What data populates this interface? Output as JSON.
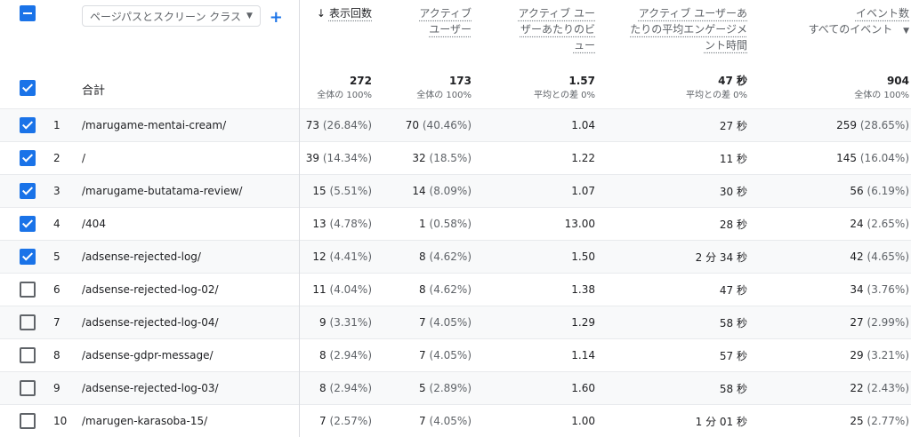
{
  "dimension_selector": "ページパスとスクリーン クラス",
  "columns": {
    "views": "表示回数",
    "active_users": "アクティブ ユーザー",
    "views_per_user": "アクティブ ユーザーあたりのビュー",
    "avg_engagement": "アクティブ ユーザーあたりの平均エンゲージメント時間",
    "events": "イベント数",
    "events_sub": "すべてのイベント"
  },
  "totals": {
    "label": "合計",
    "views": "272",
    "views_sub": "全体の 100%",
    "active_users": "173",
    "active_users_sub": "全体の 100%",
    "views_per_user": "1.57",
    "views_per_user_sub": "平均との差 0%",
    "avg_engagement": "47 秒",
    "avg_engagement_sub": "平均との差 0%",
    "events": "904",
    "events_sub": "全体の 100%"
  },
  "rows": [
    {
      "idx": "1",
      "path": "/marugame-mentai-cream/",
      "views": "73",
      "views_pct": "(26.84%)",
      "users": "70",
      "users_pct": "(40.46%)",
      "vpu": "1.04",
      "eng": "27 秒",
      "events": "259",
      "events_pct": "(28.65%)",
      "checked": true
    },
    {
      "idx": "2",
      "path": "/",
      "views": "39",
      "views_pct": "(14.34%)",
      "users": "32",
      "users_pct": "(18.5%)",
      "vpu": "1.22",
      "eng": "11 秒",
      "events": "145",
      "events_pct": "(16.04%)",
      "checked": true
    },
    {
      "idx": "3",
      "path": "/marugame-butatama-review/",
      "views": "15",
      "views_pct": "(5.51%)",
      "users": "14",
      "users_pct": "(8.09%)",
      "vpu": "1.07",
      "eng": "30 秒",
      "events": "56",
      "events_pct": "(6.19%)",
      "checked": true
    },
    {
      "idx": "4",
      "path": "/404",
      "views": "13",
      "views_pct": "(4.78%)",
      "users": "1",
      "users_pct": "(0.58%)",
      "vpu": "13.00",
      "eng": "28 秒",
      "events": "24",
      "events_pct": "(2.65%)",
      "checked": true
    },
    {
      "idx": "5",
      "path": "/adsense-rejected-log/",
      "views": "12",
      "views_pct": "(4.41%)",
      "users": "8",
      "users_pct": "(4.62%)",
      "vpu": "1.50",
      "eng": "2 分 34 秒",
      "events": "42",
      "events_pct": "(4.65%)",
      "checked": true
    },
    {
      "idx": "6",
      "path": "/adsense-rejected-log-02/",
      "views": "11",
      "views_pct": "(4.04%)",
      "users": "8",
      "users_pct": "(4.62%)",
      "vpu": "1.38",
      "eng": "47 秒",
      "events": "34",
      "events_pct": "(3.76%)",
      "checked": false
    },
    {
      "idx": "7",
      "path": "/adsense-rejected-log-04/",
      "views": "9",
      "views_pct": "(3.31%)",
      "users": "7",
      "users_pct": "(4.05%)",
      "vpu": "1.29",
      "eng": "58 秒",
      "events": "27",
      "events_pct": "(2.99%)",
      "checked": false
    },
    {
      "idx": "8",
      "path": "/adsense-gdpr-message/",
      "views": "8",
      "views_pct": "(2.94%)",
      "users": "7",
      "users_pct": "(4.05%)",
      "vpu": "1.14",
      "eng": "57 秒",
      "events": "29",
      "events_pct": "(3.21%)",
      "checked": false
    },
    {
      "idx": "9",
      "path": "/adsense-rejected-log-03/",
      "views": "8",
      "views_pct": "(2.94%)",
      "users": "5",
      "users_pct": "(2.89%)",
      "vpu": "1.60",
      "eng": "58 秒",
      "events": "22",
      "events_pct": "(2.43%)",
      "checked": false
    },
    {
      "idx": "10",
      "path": "/marugen-karasoba-15/",
      "views": "7",
      "views_pct": "(2.57%)",
      "users": "7",
      "users_pct": "(4.05%)",
      "vpu": "1.00",
      "eng": "1 分 01 秒",
      "events": "25",
      "events_pct": "(2.77%)",
      "checked": false
    }
  ],
  "icons": {
    "sort": "arrow-down-icon",
    "add": "plus-icon",
    "dropdown": "caret-down-icon"
  },
  "colors": {
    "accent": "#1a73e8",
    "row_alt": "#f8f9fa",
    "divider": "#dadce0"
  }
}
